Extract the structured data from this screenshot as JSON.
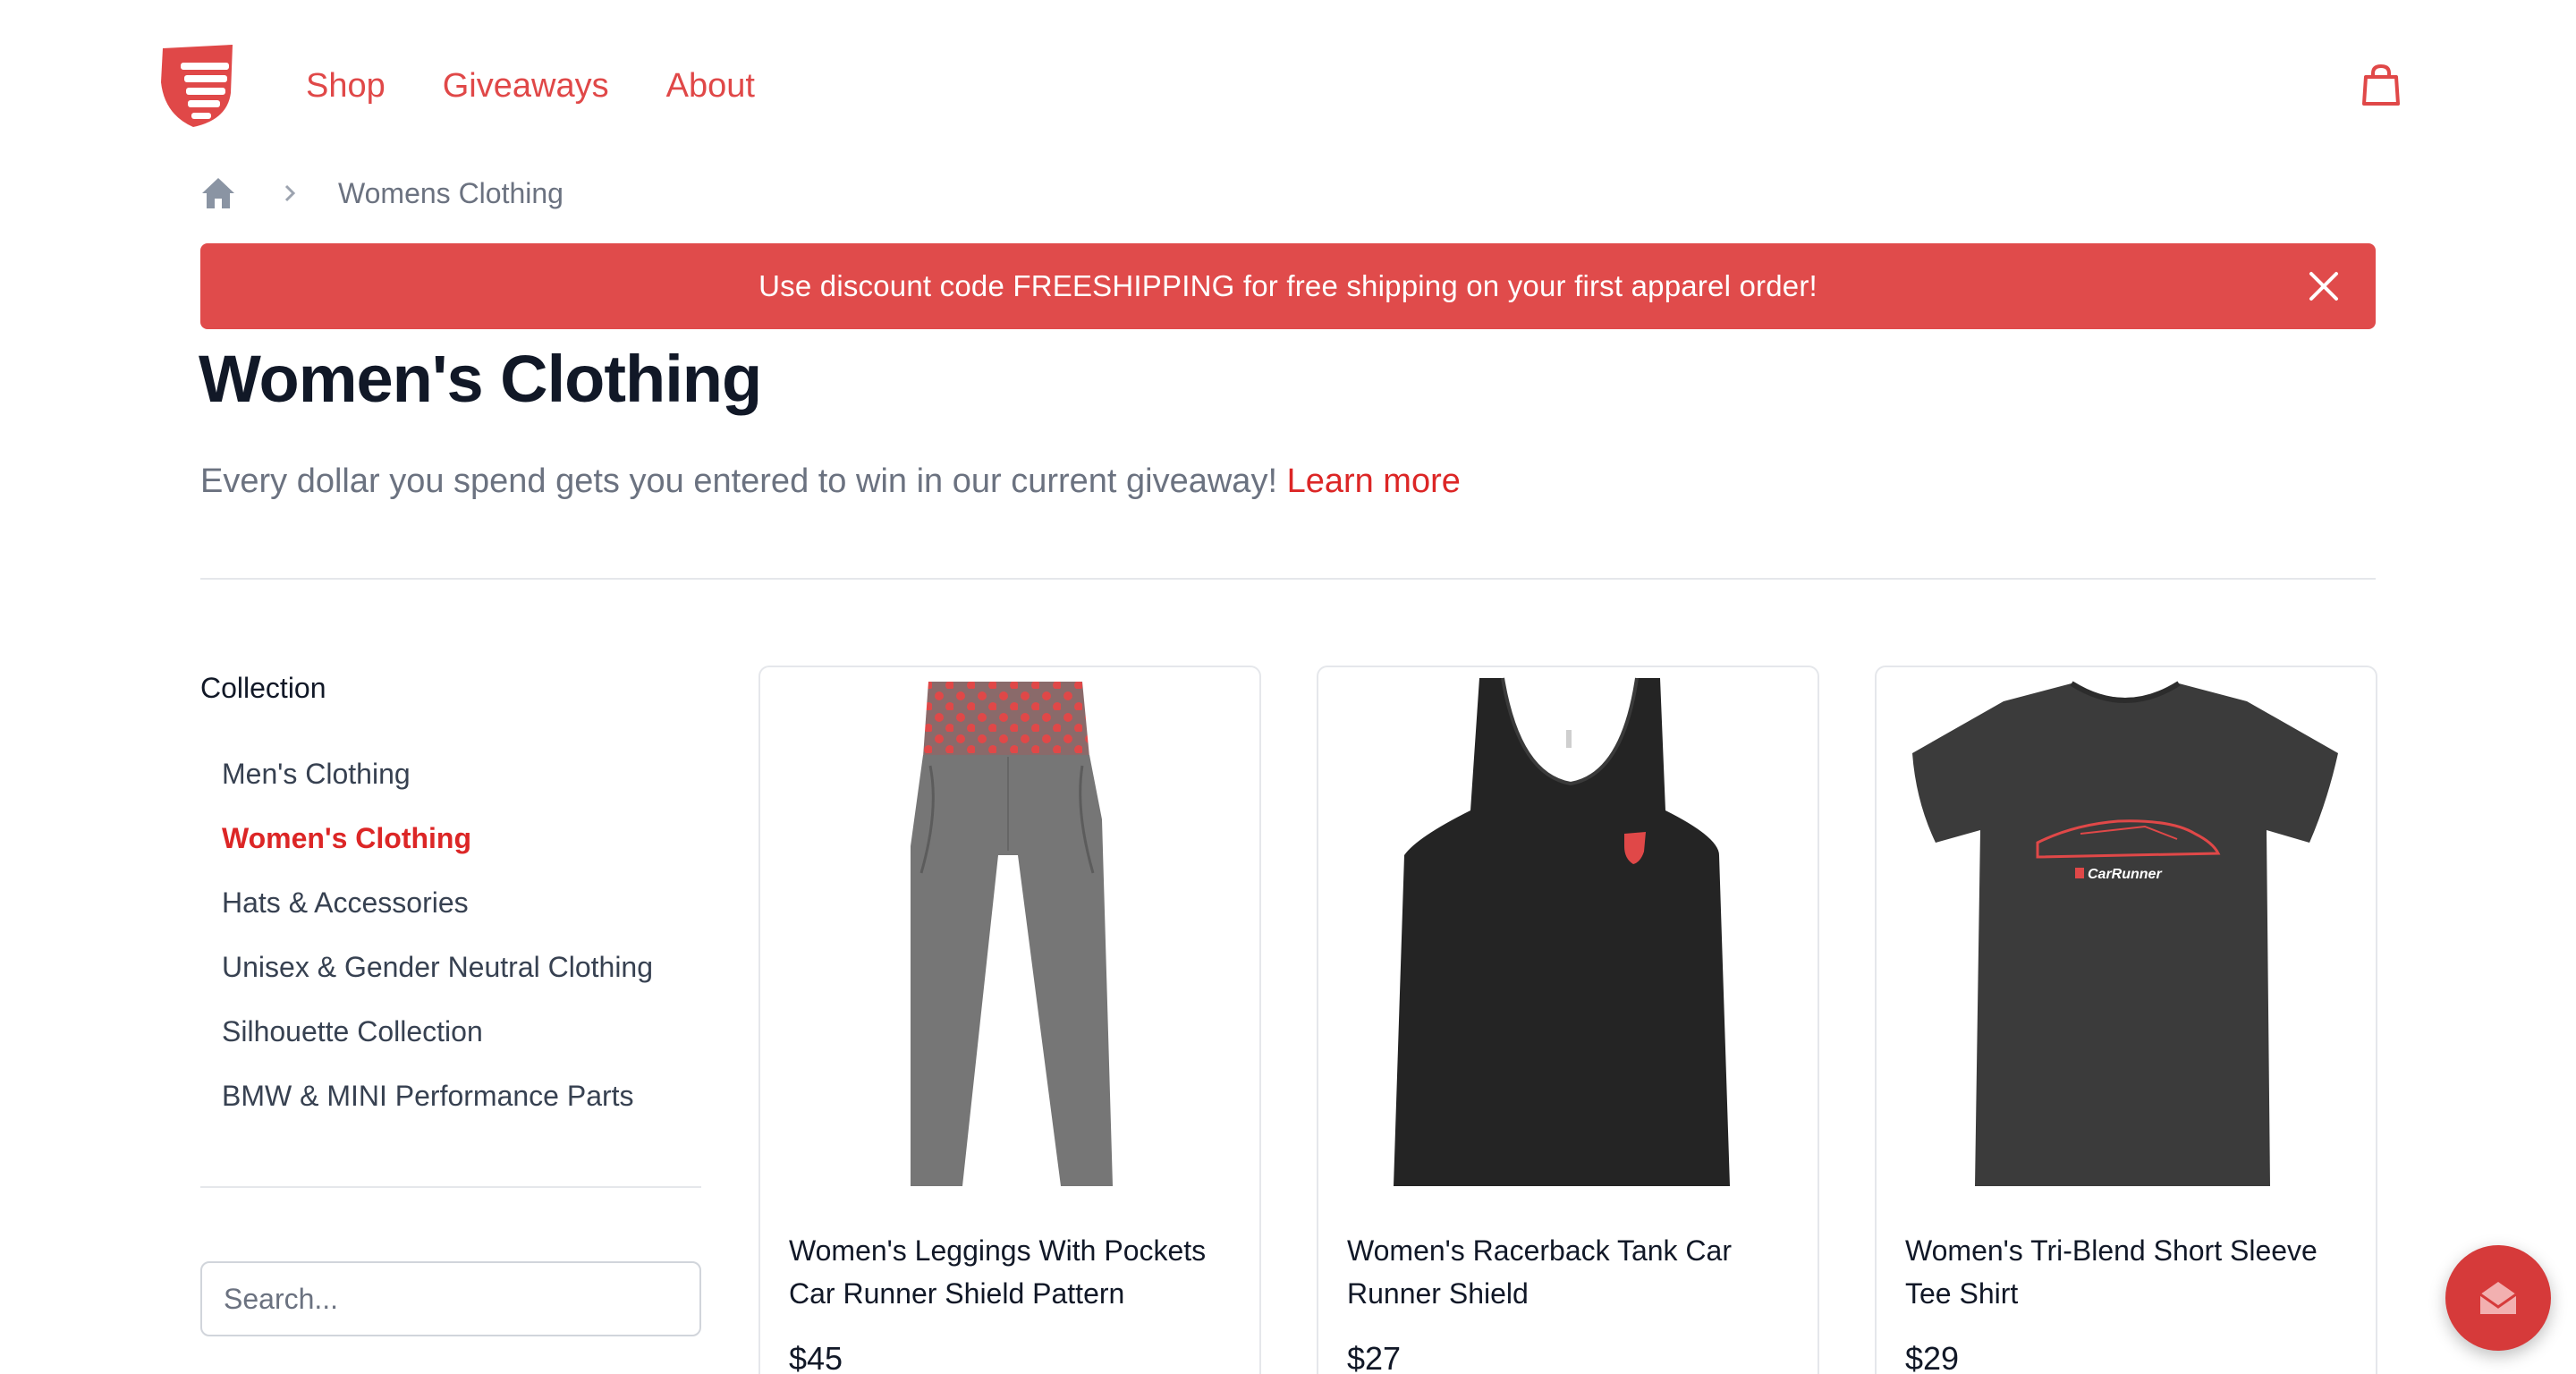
{
  "brand": {
    "accent": "#e04848",
    "link_red": "#dc2626",
    "banner_bg": "#e04b4b"
  },
  "header": {
    "logo_icon": "shield-logo-icon",
    "nav": [
      {
        "label": "Shop"
      },
      {
        "label": "Giveaways"
      },
      {
        "label": "About"
      }
    ],
    "cart_icon": "shopping-bag-icon"
  },
  "breadcrumb": {
    "home_icon": "home-icon",
    "separator_icon": "chevron-right-icon",
    "current": "Womens Clothing"
  },
  "banner": {
    "text": "Use discount code FREESHIPPING for free shipping on your first apparel order!",
    "close_icon": "close-icon"
  },
  "page": {
    "title": "Women's Clothing",
    "lead_text": "Every dollar you spend gets you entered to win in our current giveaway!",
    "lead_link": "Learn more"
  },
  "sidebar": {
    "heading": "Collection",
    "items": [
      {
        "label": "Men's Clothing",
        "active": false
      },
      {
        "label": "Women's Clothing",
        "active": true
      },
      {
        "label": "Hats & Accessories",
        "active": false
      },
      {
        "label": "Unisex & Gender Neutral Clothing",
        "active": false
      },
      {
        "label": "Silhouette Collection",
        "active": false
      },
      {
        "label": "BMW & MINI Performance Parts",
        "active": false
      }
    ],
    "search_placeholder": "Search..."
  },
  "products": [
    {
      "name": "Women's Leggings With Pockets Car Runner Shield Pattern",
      "price": "$45",
      "image": "gray-leggings-red-waistband"
    },
    {
      "name": "Women's Racerback Tank Car Runner Shield",
      "price": "$27",
      "image": "black-racerback-tank"
    },
    {
      "name": "Women's Tri-Blend Short Sleeve Tee Shirt",
      "price": "$29",
      "image": "charcoal-tee-car-graphic"
    }
  ],
  "chat": {
    "icon": "mail-open-icon"
  }
}
